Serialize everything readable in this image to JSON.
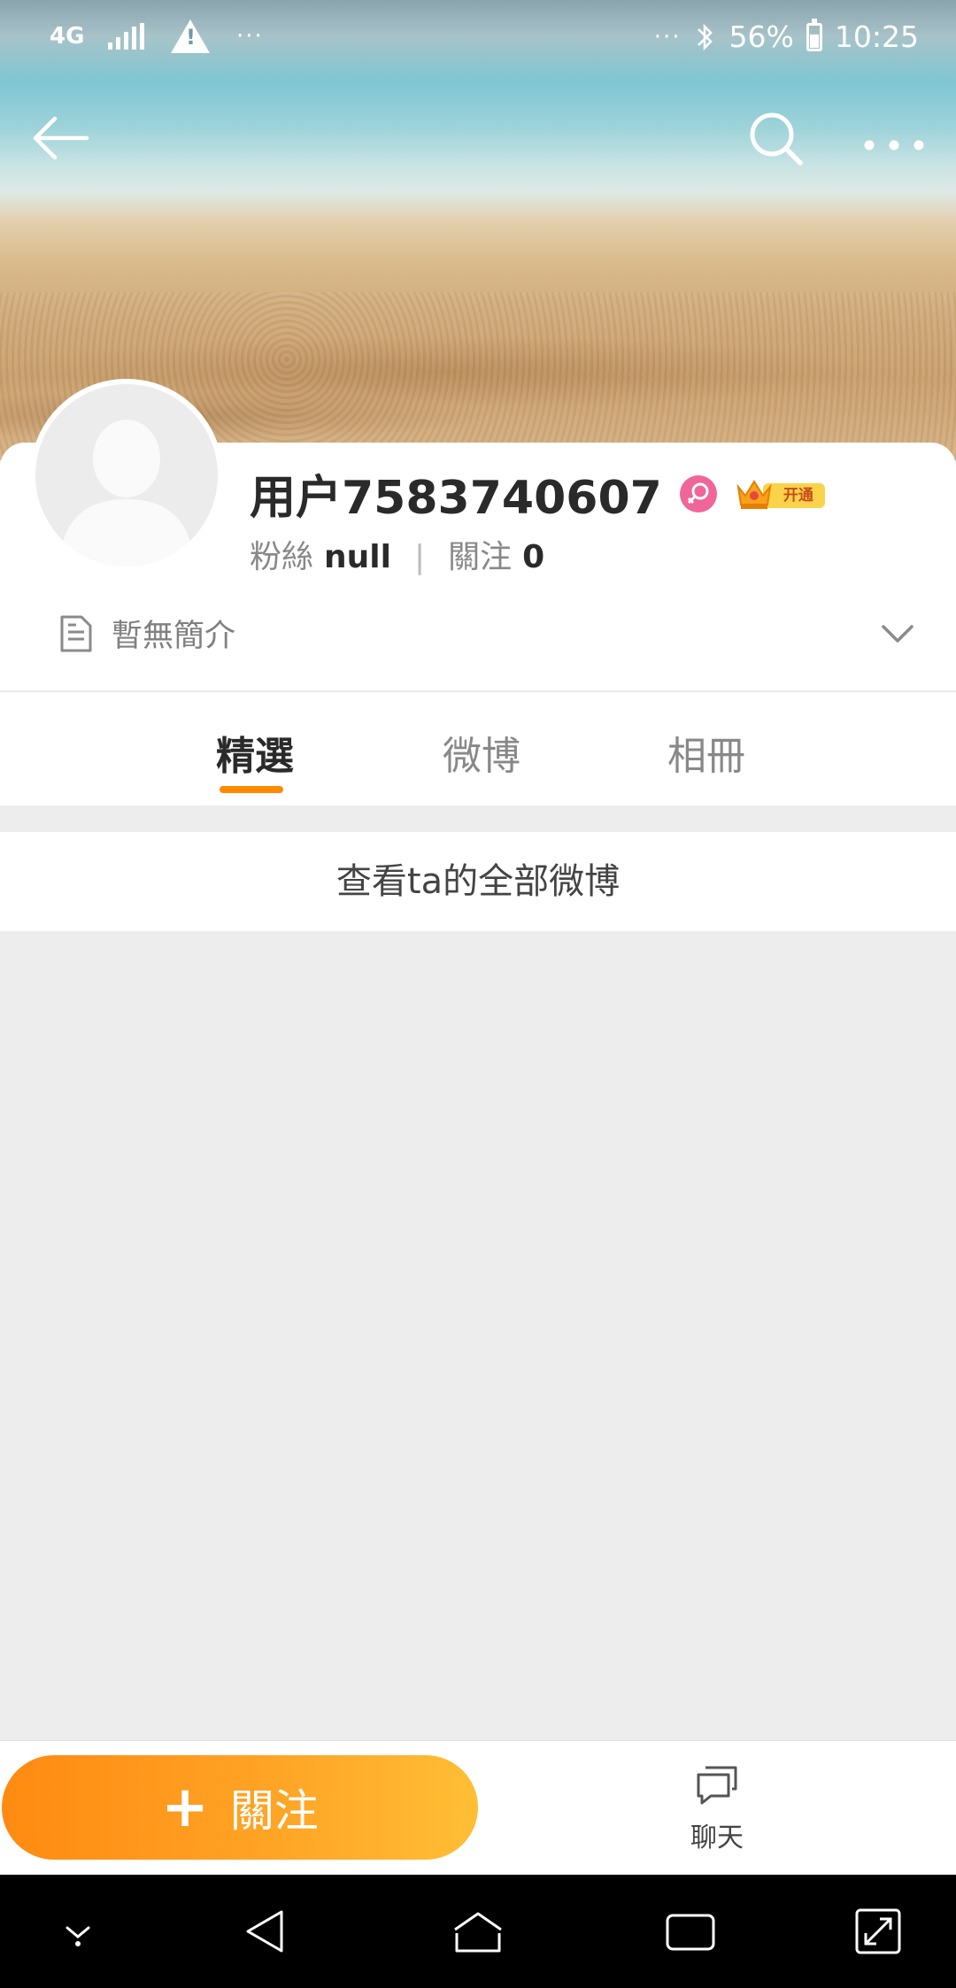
{
  "status_bar": {
    "network_type": "4G",
    "battery_percent": "56%",
    "time": "10:25",
    "left_dots": "···",
    "right_dots": "···"
  },
  "profile": {
    "username": "用户7583740607",
    "gender": "female",
    "vip_tag": "开通",
    "followers_label": "粉絲",
    "followers_value": "null",
    "following_label": "關注",
    "following_value": "0",
    "intro": "暫無簡介"
  },
  "tabs": [
    {
      "label": "精選",
      "active": true
    },
    {
      "label": "微博",
      "active": false
    },
    {
      "label": "相冊",
      "active": false
    }
  ],
  "view_all": "查看ta的全部微博",
  "actions": {
    "follow_label": "關注",
    "chat_label": "聊天"
  },
  "colors": {
    "accent": "#ff8a00",
    "female_badge": "#f0669a"
  }
}
